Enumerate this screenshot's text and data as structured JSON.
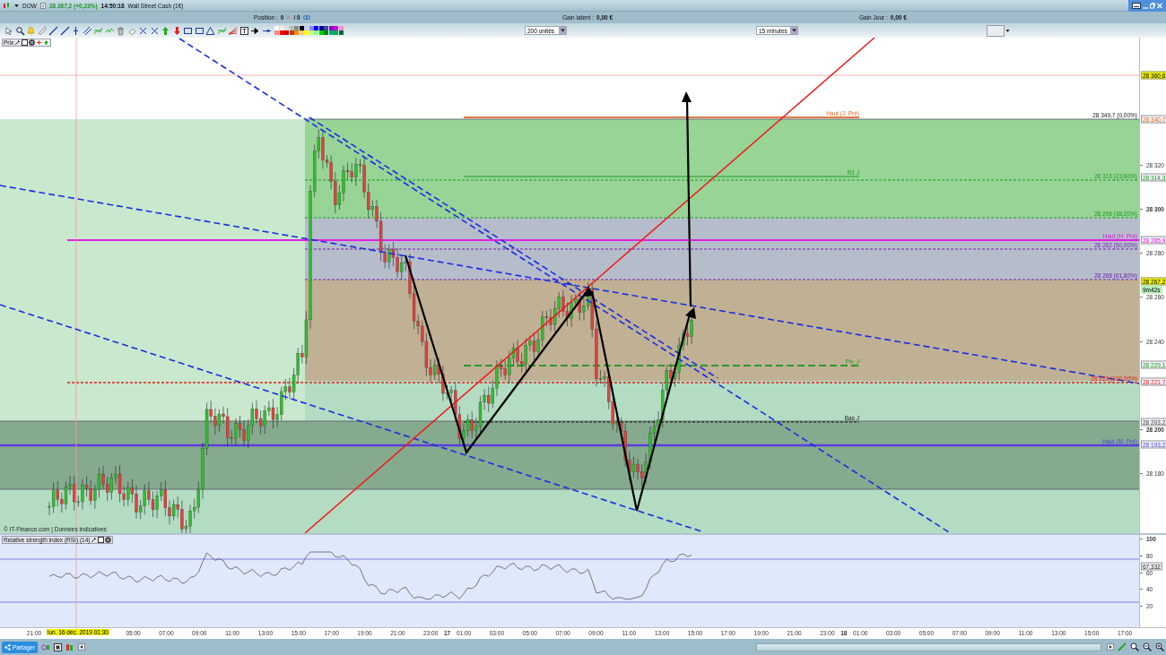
{
  "header": {
    "symbol": "DOW",
    "quote": "28 267,2 (+0,23%)",
    "time": "14:50:18",
    "instrument": "Wall Street Cash (1€)"
  },
  "position_bar": {
    "position_label": "Position :",
    "position_value": "0",
    "position_total": "/ 0",
    "latent_label": "Gain latent :",
    "latent_value": "0,00 €",
    "day_label": "Gain Jour :",
    "day_value": "0,00 €"
  },
  "toolbar": {
    "quantity": "200 unités",
    "timeframe": "15 minutes"
  },
  "chart": {
    "panel_label": "Prix",
    "credit": "© IT-Finance.com | Données indicatives",
    "line_labels": [
      {
        "text": "Haut (J. Pré)"
      },
      {
        "text": "28 349,7 (0,00%)"
      },
      {
        "text": "R1 J"
      },
      {
        "text": "28 313 (23,60%)"
      },
      {
        "text": "28 296 (38,20%)"
      },
      {
        "text": "Haut (H. Pré)"
      },
      {
        "text": "28 282 (50,00%)"
      },
      {
        "text": "28 268 (61,80%)"
      },
      {
        "text": "Piv. J"
      },
      {
        "text": "28 223 (100,00%)"
      },
      {
        "text": "Bas J"
      },
      {
        "text": "Haut (M. Pré)"
      }
    ],
    "price_ticks": [
      {
        "label": "28 320",
        "kind": "minor"
      },
      {
        "label": "28 300",
        "kind": "major"
      },
      {
        "label": "28 280",
        "kind": "minor"
      },
      {
        "label": "28 260",
        "kind": "minor"
      },
      {
        "label": "28 240",
        "kind": "minor"
      },
      {
        "label": "28 200",
        "kind": "major"
      },
      {
        "label": "28 180",
        "kind": "minor"
      }
    ],
    "price_tags": [
      {
        "text": "28 360,6",
        "kind": "highlight"
      },
      {
        "text": "28 340,7",
        "kind": "plain"
      },
      {
        "text": "28 314,3",
        "kind": "plain"
      },
      {
        "text": "28 285,9",
        "kind": "plain"
      },
      {
        "text": "28 267,2",
        "kind": "highlight"
      },
      {
        "text": "9m42s",
        "kind": "timer"
      },
      {
        "text": "28 229,1",
        "kind": "plain"
      },
      {
        "text": "28 221,7",
        "kind": "plain"
      },
      {
        "text": "28 203,2",
        "kind": "plain"
      },
      {
        "text": "28 193,2",
        "kind": "plain"
      }
    ]
  },
  "rsi": {
    "title": "Relative strength index (RSI) (14)",
    "ticks": [
      {
        "label": "100",
        "kind": "major"
      },
      {
        "label": "80",
        "kind": "minor"
      },
      {
        "label": "60",
        "kind": "minor"
      },
      {
        "label": "40",
        "kind": "minor"
      },
      {
        "label": "20",
        "kind": "minor"
      }
    ],
    "tag": "67,332"
  },
  "time_axis": {
    "ticks": [
      {
        "label": "21:00",
        "kind": "hour"
      },
      {
        "label": "lun. 16 déc. 2019 01:30",
        "kind": "cursor"
      },
      {
        "label": "05:00",
        "kind": "hour"
      },
      {
        "label": "07:00",
        "kind": "hour"
      },
      {
        "label": "09:00",
        "kind": "hour"
      },
      {
        "label": "11:00",
        "kind": "hour"
      },
      {
        "label": "13:00",
        "kind": "hour"
      },
      {
        "label": "15:00",
        "kind": "hour"
      },
      {
        "label": "17:00",
        "kind": "hour"
      },
      {
        "label": "19:00",
        "kind": "hour"
      },
      {
        "label": "21:00",
        "kind": "hour"
      },
      {
        "label": "23:00",
        "kind": "hour"
      },
      {
        "label": "17",
        "kind": "day"
      },
      {
        "label": "01:00",
        "kind": "hour"
      },
      {
        "label": "03:00",
        "kind": "hour"
      },
      {
        "label": "05:00",
        "kind": "hour"
      },
      {
        "label": "07:00",
        "kind": "hour"
      },
      {
        "label": "09:00",
        "kind": "hour"
      },
      {
        "label": "11:00",
        "kind": "hour"
      },
      {
        "label": "13:00",
        "kind": "hour"
      },
      {
        "label": "15:00",
        "kind": "hour"
      },
      {
        "label": "17:00",
        "kind": "hour"
      },
      {
        "label": "19:00",
        "kind": "hour"
      },
      {
        "label": "21:00",
        "kind": "hour"
      },
      {
        "label": "23:00",
        "kind": "hour"
      },
      {
        "label": "18",
        "kind": "day"
      },
      {
        "label": "01:00",
        "kind": "hour"
      },
      {
        "label": "03:00",
        "kind": "hour"
      },
      {
        "label": "05:00",
        "kind": "hour"
      },
      {
        "label": "07:00",
        "kind": "hour"
      },
      {
        "label": "09:00",
        "kind": "hour"
      },
      {
        "label": "11:00",
        "kind": "hour"
      },
      {
        "label": "13:00",
        "kind": "hour"
      },
      {
        "label": "15:00",
        "kind": "hour"
      },
      {
        "label": "17:00",
        "kind": "hour"
      }
    ]
  },
  "bottom_bar": {
    "share_button": "Partager"
  }
}
